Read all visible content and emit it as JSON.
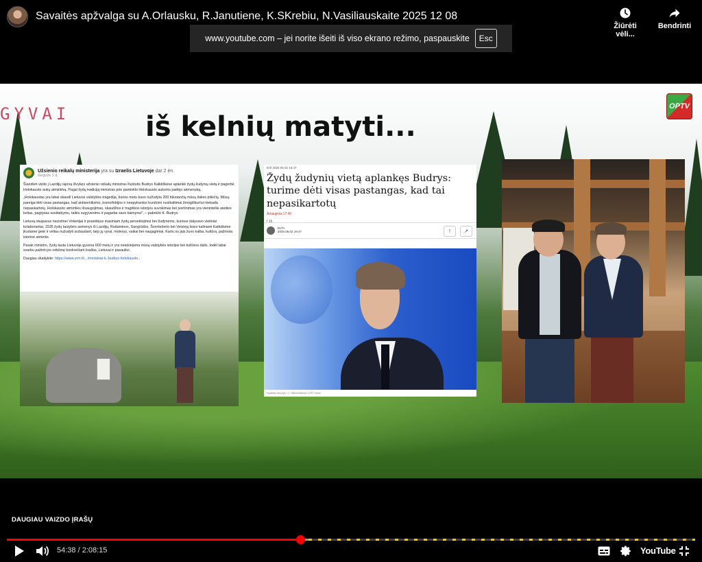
{
  "header": {
    "title": "Savaitės apžvalga su A.Orlausku, R.Janutiene, K.SKrebiu, N.Vasiliauskaite 2025 12 08",
    "watch_later_label": "Žiūrėti vėli...",
    "share_label": "Bendrinti"
  },
  "fullscreen_toast": {
    "text": "www.youtube.com – jei norite išeiti iš viso ekrano režimo, paspauskite",
    "key": "Esc"
  },
  "video": {
    "gyvai_text": "GYVAI",
    "headline": "iš kelnių matyti...",
    "logo": "OPTV",
    "fb_post": {
      "page_name": "Užsienio reikalų ministerija",
      "with_text": "yra su",
      "with_page": "Izraelis Lietuvoje",
      "time": "dar 2 ėn.",
      "date": "Gegužė 2 d.",
      "paragraphs": [
        "Šiandien vizito į Lazdijų rajoną išvykęs užsienio reikalų ministras Kęstutis Budrys Kalktiškėse aplankė žydų žudynių vietą ir pagerbė Holokausto aukų atminimą. Pagal žydų tradiciją ministras prie paminklo Holokausto aukoms padėjo akmenuką.",
        "„Holokaustas yra labai skaudi Lietuvos valstybės tragedija, kurios metu buvo nužudyta 200 tūkstančių mūsų šalies piliečių. Mūsų pareiga dėti visas pastangas, kad antisemitizmo, ksenofobijos ir neapykantos kurstomi nusikaltimai žmogiškumui niekada nepasikartotų. Holokausto atminties išsaugojimas, skaudžios ir tragiškos istorijos suvokimas bei įvertinimas yra vieninteliis ateities kelias, pagrįstas susitaikymu, taikiu sugyvenimu ir pagarba savo kaimynui\", – pabrėžė K. Budrys.",
        "Lietuvą okupavus nacistinei Vokietijai ir prasidėjus masiniam žydų persekiojimui bei žudynėms, kuriose dalyvavo vietiniai kolaborantai, 1535 žydų tautybės asmenys iš Lazdijų, Rudaminos, Sangrūdos, Šventežerio bei Veisiejų buvo kalinami Katkiškėse įkurtame gete ir vėliau nužudyti sušaudant, tarp jų vyrai, moterys, vaikai bei naujagimiai. Kartu su jais žuvo kalba, kultūra, pažinota istorinė atmintis.",
        "Pasak ministro, žydų tauta Lietuvoje gyvena 600 metų ir yra neatsiejama mūsų valstybės istorijos bei kultūros dalis, todėl labai svarbu pažinti jos reikšmę konkrečiam kraštui, Lietuvai ir pasauliui."
      ],
      "more_label": "Daugiau skaitykite:",
      "more_link": "https://www.urm.lt/.../ministras-k.-budrys-holokausto..."
    },
    "news": {
      "meta": "lrt.lt  2025.05.02  16:47",
      "title": "Žydų žudynių vietą aplankęs Budrys: turime dėti visas pastangas, kad tai nepasikartotų",
      "updated": "Atnaujinta 17:40",
      "share": "f  16",
      "author": "ELTA",
      "author_date": "2025.05.02 16:47",
      "btn_alert": "!",
      "btn_share": "↗",
      "caption": "Kęstutis Budrys / J. Stacevičiaus / LRT nuotr."
    }
  },
  "controls": {
    "more_videos_label": "DAUGIAU VAIZDO ĮRAŠŲ",
    "current_time": "54:38",
    "duration": "2:08:15",
    "time_text": "54:38 / 2:08:15",
    "progress_fraction": 0.426,
    "buffered_fraction": 0.44,
    "logo": "YouTube"
  },
  "colors": {
    "progress": "#ff0000",
    "chapter_marker": "#f2c30f",
    "headline": "#111111",
    "gyvai": "#c84a62"
  },
  "icons": [
    "watch-later-icon",
    "share-icon",
    "play-icon",
    "volume-icon",
    "subtitles-icon",
    "settings-icon",
    "exit-fullscreen-icon"
  ]
}
